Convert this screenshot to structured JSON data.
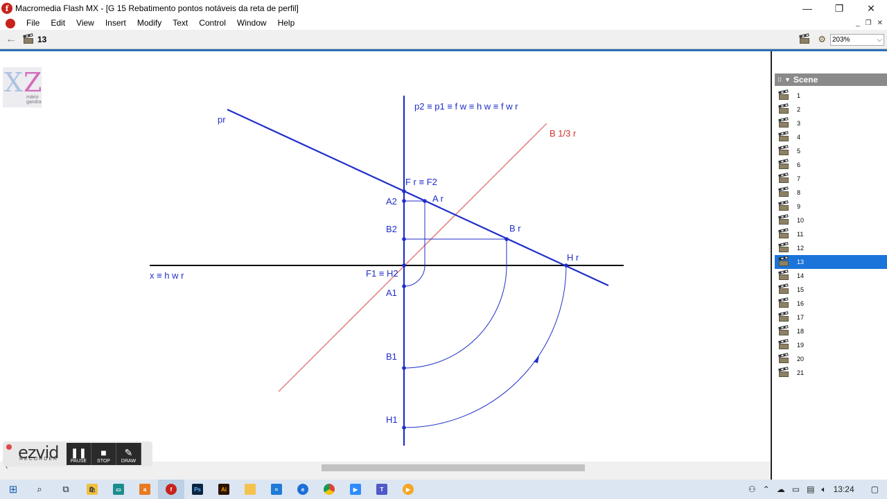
{
  "window": {
    "title": "Macromedia Flash MX - [G 15 Rebatimento pontos notáveis da reta de perfil]",
    "minimize": "—",
    "restore": "❐",
    "close": "✕"
  },
  "menu": {
    "items": [
      "File",
      "Edit",
      "View",
      "Insert",
      "Modify",
      "Text",
      "Control",
      "Window",
      "Help"
    ]
  },
  "mdi": {
    "min": "_",
    "restore": "❐",
    "close": "✕"
  },
  "toolbar": {
    "back": "←",
    "current_scene": "13",
    "zoom": "203%"
  },
  "panel": {
    "title": "Scene",
    "scenes": [
      "1",
      "2",
      "3",
      "4",
      "5",
      "6",
      "7",
      "8",
      "9",
      "10",
      "11",
      "12",
      "13",
      "14",
      "15",
      "16",
      "17",
      "18",
      "19",
      "20",
      "21"
    ],
    "selected": "13"
  },
  "logo": {
    "name": "mário gandra"
  },
  "drawing": {
    "labels": {
      "pr": "pr",
      "p2": "p2 ≡ p1 ≡ f w ≡ h w ≡ f w r",
      "b13": "B 1/3 r",
      "fr": "F r ≡ F2",
      "a2": "A2",
      "ar": "A r",
      "b2": "B2",
      "br": "B r",
      "hr": "H r",
      "x": "x ≡ h w r",
      "f1": "F1 ≡ H2",
      "a1": "A1",
      "b1": "B1",
      "h1": "H1"
    },
    "colors": {
      "blue": "#1f2ec9",
      "red": "#e06060",
      "black": "#000000"
    }
  },
  "ezvid": {
    "logo": "ezvid",
    "sub": "RECORDER",
    "pause": "PAUSE",
    "stop": "STOP",
    "draw": "DRAW"
  },
  "taskbar": {
    "apps": [
      "windows",
      "search",
      "task-view",
      "store",
      "teams-chat",
      "office",
      "flash",
      "photoshop",
      "illustrator",
      "explorer",
      "edge-legacy",
      "edge",
      "chrome",
      "zoom",
      "teams",
      "media"
    ],
    "clock": "13:24"
  }
}
